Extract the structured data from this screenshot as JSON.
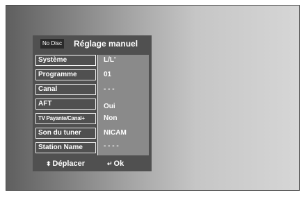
{
  "header": {
    "disc_status": "No Disc",
    "title": "Réglage manuel"
  },
  "settings": [
    {
      "label": "Système",
      "value": "L/L'"
    },
    {
      "label": "Programme",
      "value": "01"
    },
    {
      "label": "Canal",
      "value": "- - -"
    },
    {
      "label": "AFT",
      "value": "Oui"
    },
    {
      "label": "TV Payante/Canal+",
      "value": "Non"
    },
    {
      "label": "Son du tuner",
      "value": "NICAM"
    },
    {
      "label": "Station Name",
      "value": "- - - -"
    }
  ],
  "footer": {
    "move_icon": "updown-arrow-icon",
    "move_glyph": "⬍",
    "move_label": "Déplacer",
    "ok_icon": "enter-key-icon",
    "ok_glyph": "↵",
    "ok_label": "Ok"
  }
}
